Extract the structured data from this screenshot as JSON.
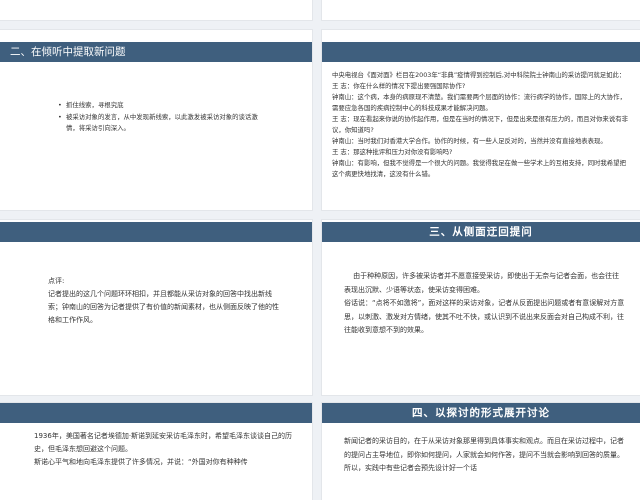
{
  "slide2": {
    "title": "二、在倾听中提取新问题",
    "bullets": [
      "抓住线索，寻根究底",
      "被采访对象的发言，从中发现新线索，以此激发被采访对象的谈话激情，将采访引向深入。"
    ]
  },
  "slide3": {
    "lines": [
      "中央电视台《面对面》栏目在2003年“非典”疫情得到控制后,对中科院院士钟南山的采访提问就足如此：",
      "王 志：你在什么样的情况下提出要强国际协作?",
      "钟南山：这个病，本身的病原现不清楚。我们需要两个层面的协作：流行病学的协作，国际上的大协作，需要应急各国的疾病控制中心的科技成果才能解决问题。",
      "王 志：现在看起来你说的协作起作用，但是在当时的情况下，但是出来是很有压力的，而且对你来说有非议，你知道吗?",
      "钟南山：当时我们对香港大学合作。协作的时候，有一些人足反对的，当然并没有直接地表表现。",
      "王 志：那这种批评和压力对你没有影响吗?",
      "钟南山：有影响，但我不觉得是一个很大的问题。我觉得我足在做一些学术上的互相支持，同时我希望把这个病更快地找清，这没有什么错。"
    ]
  },
  "slide4": {
    "lines": [
      "点评:",
      "记者提出的这几个问题环环相扣，并且都能从采访对象的回答中找出新线索；钟南山的回答为记者提供了有价值的新闻素材，也从侧面反映了他的性格和工作作风。"
    ]
  },
  "slide5": {
    "title": "三、从侧面迂回提问",
    "paras": [
      "由于种种原因，许多被采访者并不愿意接受采访，即使出于无奈与记者会面，也会往往表现出沉默、少语等状态，使采访变得困难。",
      "俗话说：“点将不如激将”，面对这样的采访对象，记者从反面提出问题或者有意误解对方意思，以刺激、激发对方情绪，使其不吐不快，或认识到不说出来反面会对自己构成不利，往往能收到意想不到的效果。"
    ]
  },
  "slide6": {
    "lines": [
      "1936年，美国著名记者埃德加·斯诺到延安采访毛泽东时，希望毛泽东谈谈自己的历史，但毛泽东想回避这个问题。",
      "斯诺心平气和地向毛泽东提供了许多情况，并说：“外国对你有种种传"
    ]
  },
  "slide7": {
    "title": "四、以探讨的形式展开讨论",
    "lines": [
      "新闻记者的采访目的，在于从采访对象那里得到具体事实和观点。而且在采访过程中，记者的提问占主导地位，即你如何提问，人家就会如何作答，提问不当就会影响到回答的质量。所以，实践中有些记者会预先设计好一个话"
    ]
  }
}
